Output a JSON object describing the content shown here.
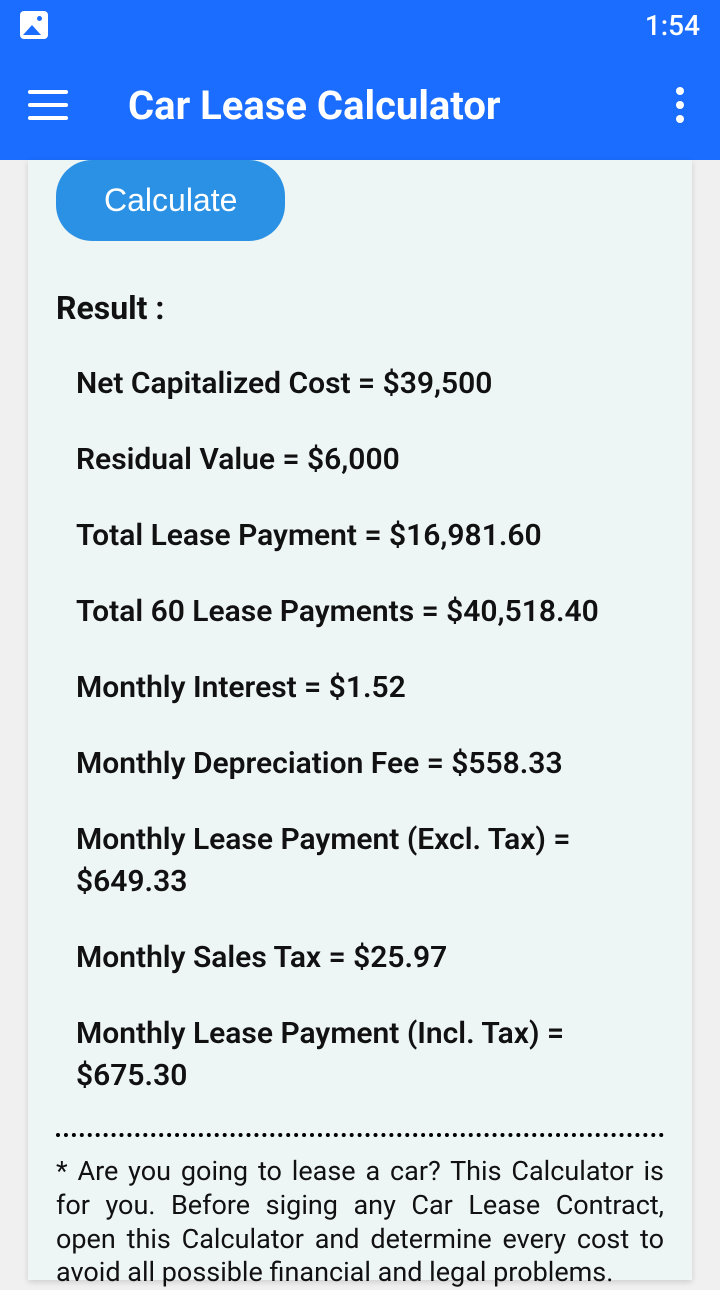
{
  "status": {
    "time": "1:54"
  },
  "appbar": {
    "title": "Car Lease Calculator"
  },
  "button": {
    "calculate": "Calculate"
  },
  "result": {
    "header": "Result :",
    "lines": [
      "Net Capitalized Cost = $39,500",
      "Residual Value = $6,000",
      "Total Lease Payment = $16,981.60",
      "Total 60 Lease Payments = $40,518.40",
      "Monthly Interest = $1.52",
      "Monthly Depreciation Fee = $558.33",
      "Monthly Lease Payment (Excl. Tax) = $649.33",
      "Monthly Sales Tax = $25.97",
      "Monthly Lease Payment (Incl. Tax) = $675.30"
    ]
  },
  "footnote": "* Are you going to lease a car? This Calculator is for you. Before siging any Car Lease Contract, open this Calculator and determine every cost to avoid all possible financial and legal problems."
}
